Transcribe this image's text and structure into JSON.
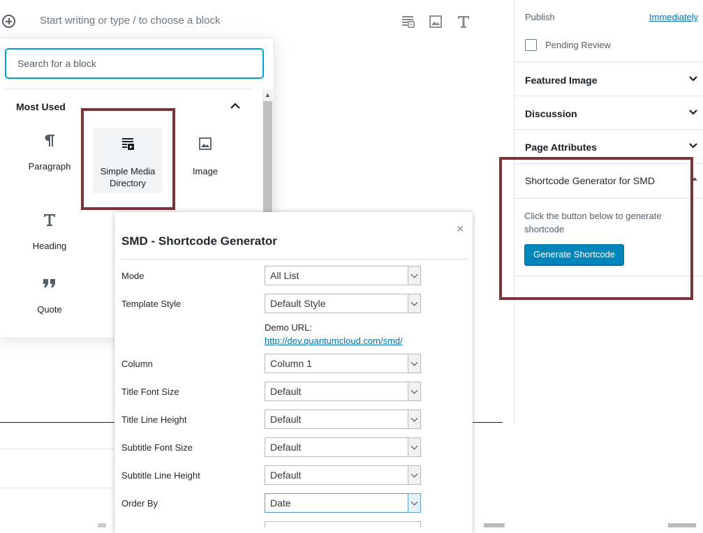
{
  "editor": {
    "placeholder": "Start writing or type / to choose a block",
    "toolbar_icons": [
      "smd-block-icon",
      "image-icon",
      "heading-icon"
    ]
  },
  "inserter": {
    "search_placeholder": "Search for a block",
    "section_title": "Most Used",
    "blocks": [
      {
        "label": "Paragraph",
        "icon": "paragraph-icon"
      },
      {
        "label": "Simple Media Directory",
        "label_line1": "Simple Media",
        "label_line2": "Directory",
        "icon": "media-directory-icon"
      },
      {
        "label": "Image",
        "icon": "image-icon"
      },
      {
        "label": "Heading",
        "icon": "heading-icon"
      },
      {
        "label": "Quote",
        "icon": "quote-icon"
      }
    ]
  },
  "modal": {
    "title": "SMD - Shortcode Generator",
    "close": "×",
    "demo_label": "Demo URL:",
    "demo_url": "http://dev.quantumcloud.com/smd/",
    "fields": [
      {
        "label": "Mode",
        "value": "All List"
      },
      {
        "label": "Template Style",
        "value": "Default Style"
      },
      {
        "label": "Column",
        "value": "Column 1"
      },
      {
        "label": "Title Font Size",
        "value": "Default"
      },
      {
        "label": "Title Line Height",
        "value": "Default"
      },
      {
        "label": "Subtitle Font Size",
        "value": "Default"
      },
      {
        "label": "Subtitle Line Height",
        "value": "Default"
      },
      {
        "label": "Order By",
        "value": "Date"
      }
    ]
  },
  "sidebar": {
    "publish_label": "Publish",
    "publish_value": "Immediately",
    "pending_review": "Pending Review",
    "featured_image": "Featured Image",
    "discussion": "Discussion",
    "page_attributes": "Page Attributes",
    "shortcode_title": "Shortcode Generator for SMD",
    "shortcode_desc_line1": "Click the button below to generate",
    "shortcode_desc_line2": "shortcode",
    "generate_button": "Generate Shortcode"
  },
  "colors": {
    "highlight_box": "#7b3438",
    "primary_button": "#0085ba",
    "link": "#0073aa",
    "focus": "#00a0d2"
  }
}
